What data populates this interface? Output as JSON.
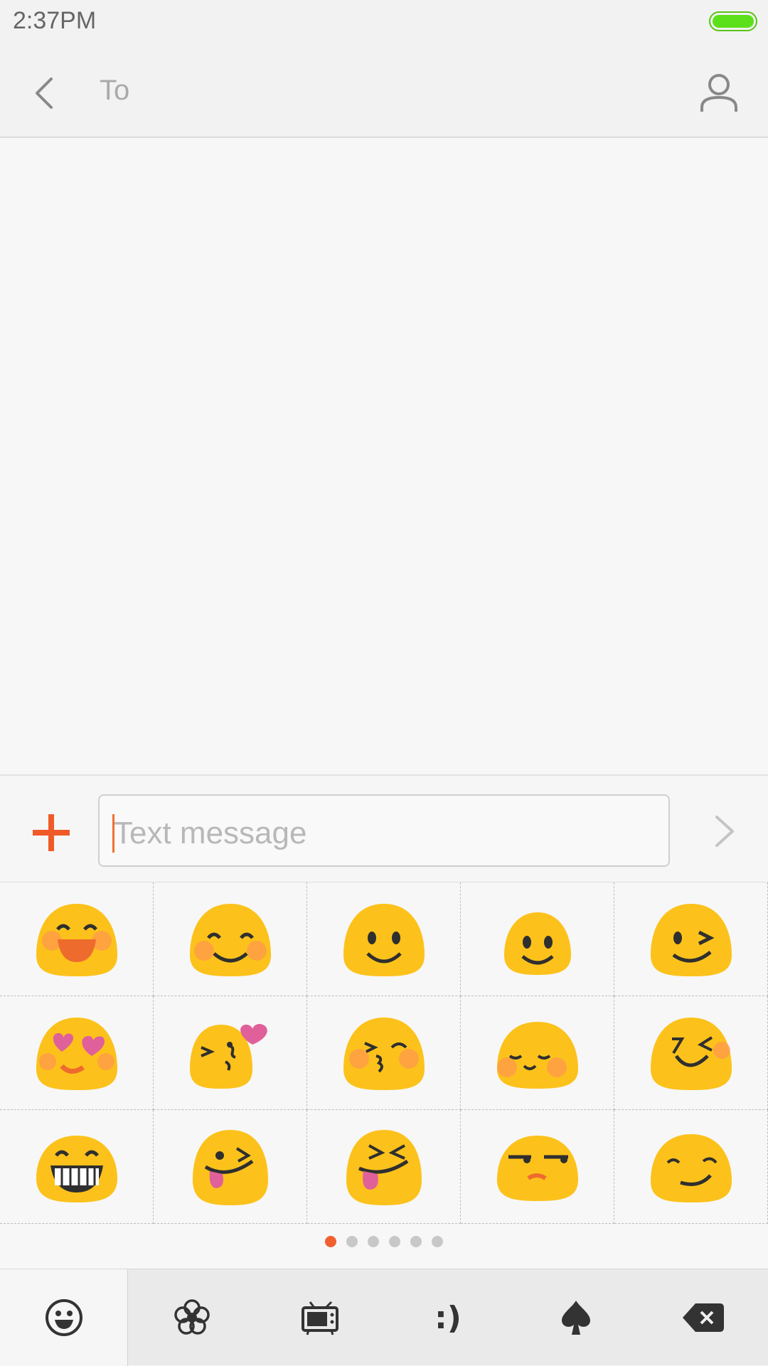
{
  "status_bar": {
    "time": "2:37PM",
    "battery_color": "#5ce01a"
  },
  "header": {
    "to_label": "To",
    "back_icon": "chevron-left-icon",
    "contact_icon": "person-icon"
  },
  "compose": {
    "placeholder": "Text message",
    "add_icon": "plus-icon",
    "send_icon": "chevron-right-icon",
    "accent": "#f06030"
  },
  "emoji_panel": {
    "emojis": [
      "laughing-blush-emoji",
      "smiling-eyes-blush-emoji",
      "smile-emoji",
      "simple-smile-emoji",
      "wink-emoji",
      "heart-eyes-emoji",
      "blowing-kiss-emoji",
      "kissing-closed-eyes-emoji",
      "relieved-emoji",
      "squinting-wink-emoji",
      "grin-emoji",
      "tongue-wink-emoji",
      "tongue-squint-emoji",
      "unamused-emoji",
      "smirk-emoji"
    ],
    "page_count": 6,
    "current_page": 1
  },
  "tabs": [
    {
      "name": "emoji-tab",
      "icon": "smiley-icon"
    },
    {
      "name": "flower-tab",
      "icon": "flower-icon"
    },
    {
      "name": "tv-tab",
      "icon": "tv-icon"
    },
    {
      "name": "emoticon-tab",
      "label": ":)"
    },
    {
      "name": "spade-tab",
      "icon": "spade-icon"
    },
    {
      "name": "delete-tab",
      "icon": "backspace-icon"
    }
  ]
}
